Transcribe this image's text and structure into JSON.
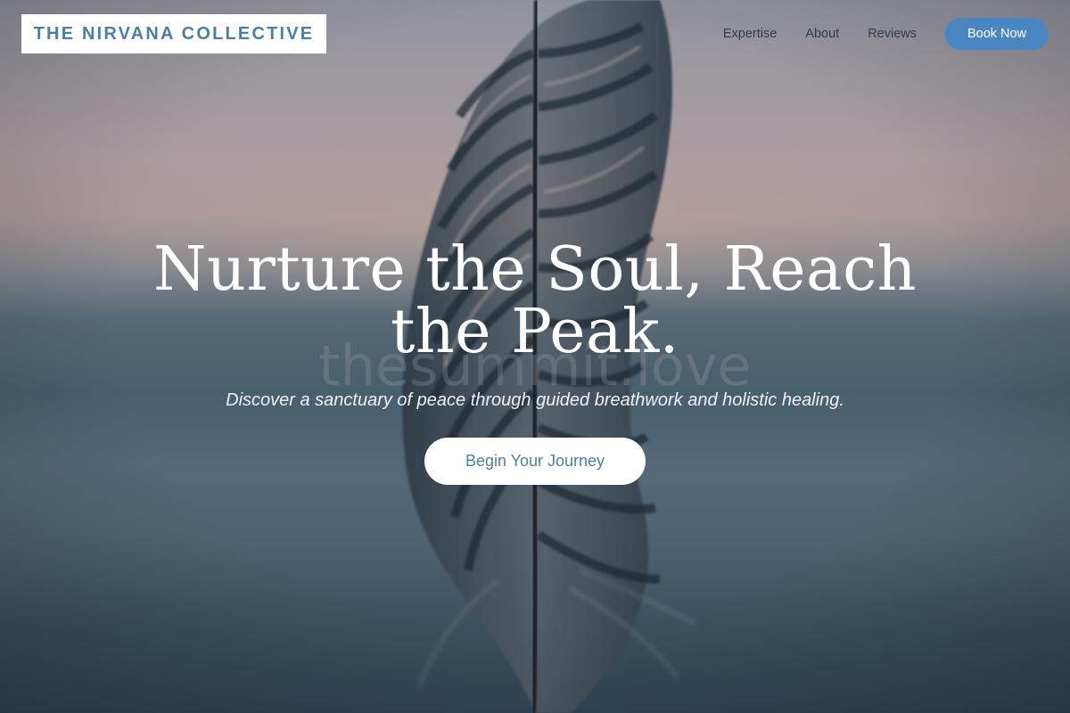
{
  "header": {
    "logo_text": "THE NIRVANA COLLECTIVE",
    "nav": [
      {
        "label": "Expertise"
      },
      {
        "label": "About"
      },
      {
        "label": "Reviews"
      }
    ],
    "book_label": "Book Now"
  },
  "hero": {
    "headline": "Nurture the Soul, Reach the Peak.",
    "watermark": "thesummit.love",
    "subtitle": "Discover a sanctuary of peace through guided breathwork and holistic healing.",
    "cta_label": "Begin Your Journey",
    "background_image": "feather-photo"
  },
  "colors": {
    "brand": "#4a7fa6",
    "button": "#4a86c2",
    "text_light": "#ffffff"
  }
}
